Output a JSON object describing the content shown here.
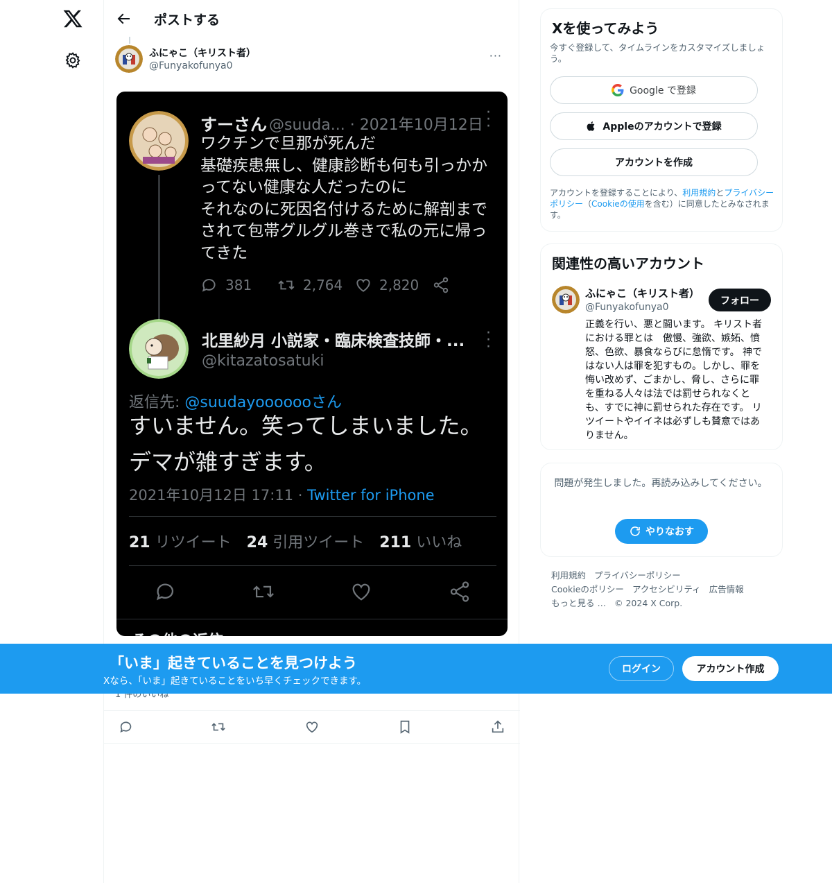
{
  "header": {
    "title": "ポストする"
  },
  "post": {
    "author_name": "ふにゃこ（キリスト者）",
    "author_handle": "@Funyakofunya0",
    "more_label": "···"
  },
  "embedded": {
    "orig": {
      "name": "すーさん",
      "meta": "@suuda... · 2021年10月12日",
      "body": "ワクチンで旦那が死んだ\n基礎疾患無し、健康診断も何も引っかか\nってない健康な人だったのに\nそれなのに死因名付けるために解剖まで\nされて包帯グルグル巻きで私の元に帰っ\nてきた",
      "replies": "381",
      "retweets": "2,764",
      "likes": "2,820"
    },
    "reply": {
      "name": "北里紗月 小説家・臨床検査技師・...",
      "handle": "@kitazatosatuki",
      "reply_prefix": "返信先: ",
      "reply_to": "@suudayoooooo",
      "reply_suffix": "さん",
      "body": "すいません。笑ってしまいました。デマが雑すぎます。",
      "time": "2021年10月12日 17:11 · ",
      "source": "Twitter for iPhone",
      "rt_num": "21",
      "rt_label": "リツイート",
      "qt_num": "24",
      "qt_label": "引用ツイート",
      "like_num": "211",
      "like_label": "いいね"
    },
    "peek": "その他の返信"
  },
  "likes_peek": "1 件のいいね",
  "signup_card": {
    "title": "Xを使ってみよう",
    "subtitle": "今すぐ登録して、タイムラインをカスタマイズしましょう。",
    "google_label": "Google で登録",
    "apple_label": "Appleのアカウントで登録",
    "create_label": "アカウントを作成",
    "legal_1": "アカウントを登録することにより、",
    "legal_terms": "利用規約",
    "legal_2": "と",
    "legal_privacy": "プライバシーポリシー",
    "legal_3": "（",
    "legal_cookie": "Cookieの使用",
    "legal_4": "を含む）に同意したとみなされます。"
  },
  "related": {
    "title": "関連性の高いアカウント",
    "name": "ふにゃこ（キリスト者）",
    "handle": "@Funyakofunya0",
    "follow_label": "フォロー",
    "bio": "正義を行い、悪と闘います。 キリスト者における罪とは　傲慢、強欲、嫉妬、憤怒、色欲、暴食ならびに怠惰です。 神ではない人は罪を犯すもの。しかし、罪を悔い改めず、ごまかし、脅し、さらに罪を重ねる人々は法では罰せられなくとも、すでに神に罰せられた存在です。 リツイートやイイネは必ずしも賛意ではありません。"
  },
  "error_card": {
    "message": "問題が発生しました。再読み込みしてください。",
    "retry_label": "やりなおす"
  },
  "footer": {
    "links": [
      "利用規約",
      "プライバシーポリシー",
      "Cookieのポリシー",
      "アクセシビリティ",
      "広告情報",
      "もっと見る …",
      "© 2024 X Corp."
    ]
  },
  "banner": {
    "title": "「いま」起きていることを見つけよう",
    "subtitle": "Xなら、「いま」起きていることをいち早くチェックできます。",
    "login_label": "ログイン",
    "signup_label": "アカウント作成"
  },
  "colors": {
    "accent": "#1d9bf0",
    "text": "#0f1419",
    "muted": "#536471",
    "dark_bg": "#000000"
  }
}
